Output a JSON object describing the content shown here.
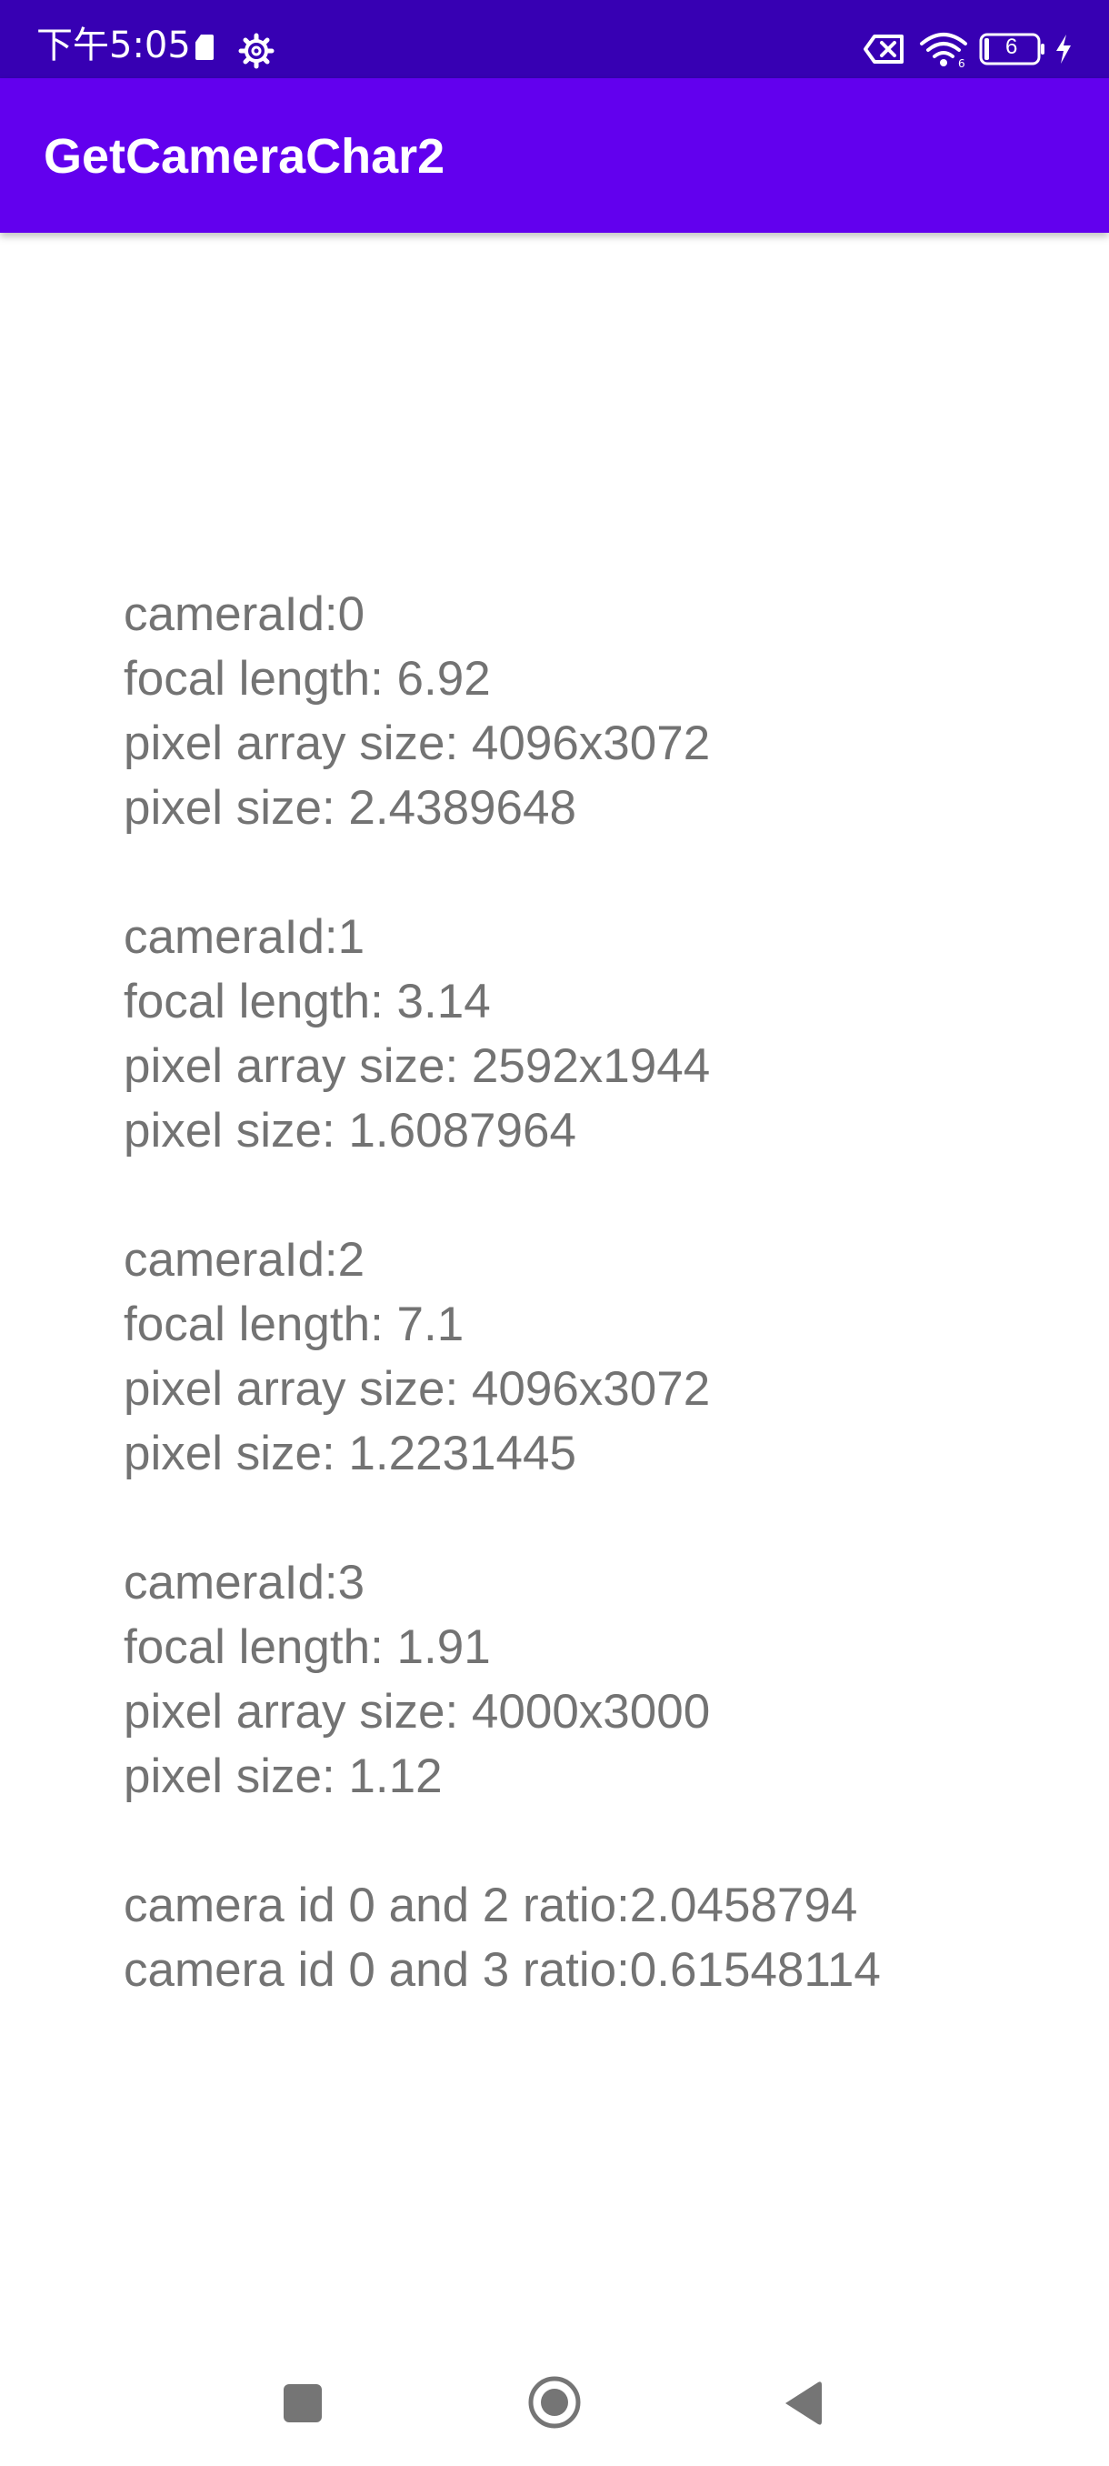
{
  "status_bar": {
    "time": "下午5:05",
    "battery_level": "6",
    "icons": [
      "sim-card-icon",
      "gear-icon",
      "notification-blocked-icon",
      "wifi-icon",
      "battery-icon",
      "charging-icon"
    ]
  },
  "app_bar": {
    "title": "GetCameraChar2"
  },
  "cameras": [
    {
      "id_line": "cameraId:0",
      "focal_line": "focal length: 6.92",
      "array_line": "pixel array size: 4096x3072",
      "pixel_line": "pixel size: 2.4389648"
    },
    {
      "id_line": "cameraId:1",
      "focal_line": "focal length: 3.14",
      "array_line": "pixel array size: 2592x1944",
      "pixel_line": "pixel size: 1.6087964"
    },
    {
      "id_line": "cameraId:2",
      "focal_line": "focal length: 7.1",
      "array_line": "pixel array size: 4096x3072",
      "pixel_line": "pixel size: 1.2231445"
    },
    {
      "id_line": "cameraId:3",
      "focal_line": "focal length: 1.91",
      "array_line": "pixel array size: 4000x3000",
      "pixel_line": "pixel size: 1.12"
    }
  ],
  "ratios": [
    "camera id 0 and 2 ratio:2.0458794",
    "camera id 0 and 3 ratio:0.61548114"
  ],
  "nav_bar": {
    "icons": [
      "recents-square-icon",
      "home-circle-icon",
      "back-triangle-icon"
    ]
  },
  "colors": {
    "status_bar": "#3700b3",
    "app_bar": "#6200ee",
    "body_text": "#737373",
    "nav_icons": "#757575"
  }
}
